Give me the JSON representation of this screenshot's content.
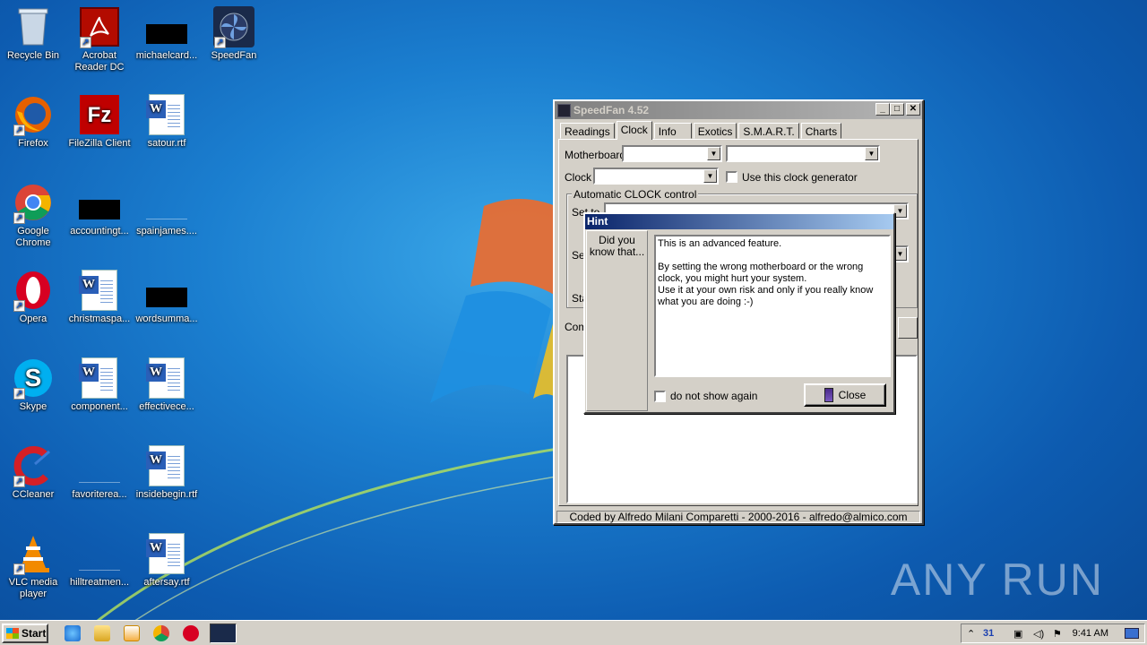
{
  "desktop": {
    "icons": [
      {
        "label": "Recycle Bin"
      },
      {
        "label": "Acrobat Reader DC"
      },
      {
        "label": "michaelcard..."
      },
      {
        "label": "SpeedFan"
      },
      {
        "label": "Firefox"
      },
      {
        "label": "FileZilla Client"
      },
      {
        "label": "satour.rtf"
      },
      {
        "label": "Google Chrome"
      },
      {
        "label": "accountingt..."
      },
      {
        "label": "spainjames...."
      },
      {
        "label": "Opera"
      },
      {
        "label": "christmaspa..."
      },
      {
        "label": "wordsumma..."
      },
      {
        "label": "Skype"
      },
      {
        "label": "component..."
      },
      {
        "label": "effectivece..."
      },
      {
        "label": "CCleaner"
      },
      {
        "label": "favoriterea..."
      },
      {
        "label": "insidebegin.rtf"
      },
      {
        "label": "VLC media player"
      },
      {
        "label": "hilltreatmen..."
      },
      {
        "label": "aftersay.rtf"
      }
    ],
    "watermark": "ANY RUN"
  },
  "speedfan": {
    "title": "SpeedFan 4.52",
    "tabs": [
      "Readings",
      "Clock",
      "Info",
      "Exotics",
      "S.M.A.R.T.",
      "Charts"
    ],
    "active_tab": "Clock",
    "motherboard_label": "Motherboard",
    "clock_label": "Clock",
    "use_clock_generator": "Use this clock generator",
    "auto_group": "Automatic CLOCK control",
    "set_to_label": "Set to",
    "se_label": "Se",
    "sta_label": "Sta",
    "com_label": "Com",
    "status": "Coded by Alfredo Milani Comparetti - 2000-2016 - alfredo@almico.com"
  },
  "hint": {
    "title": "Hint",
    "did_you_know": "Did you know that...",
    "text_line1": "This is an advanced feature.",
    "text_line2": "By setting the wrong motherboard or the wrong clock, you might hurt your system.",
    "text_line3": "Use it at your own risk and only if you really know what you are doing :-)",
    "do_not_show": "do not show again",
    "close_button": "Close"
  },
  "taskbar": {
    "start_label": "Start",
    "time": "9:41 AM"
  }
}
